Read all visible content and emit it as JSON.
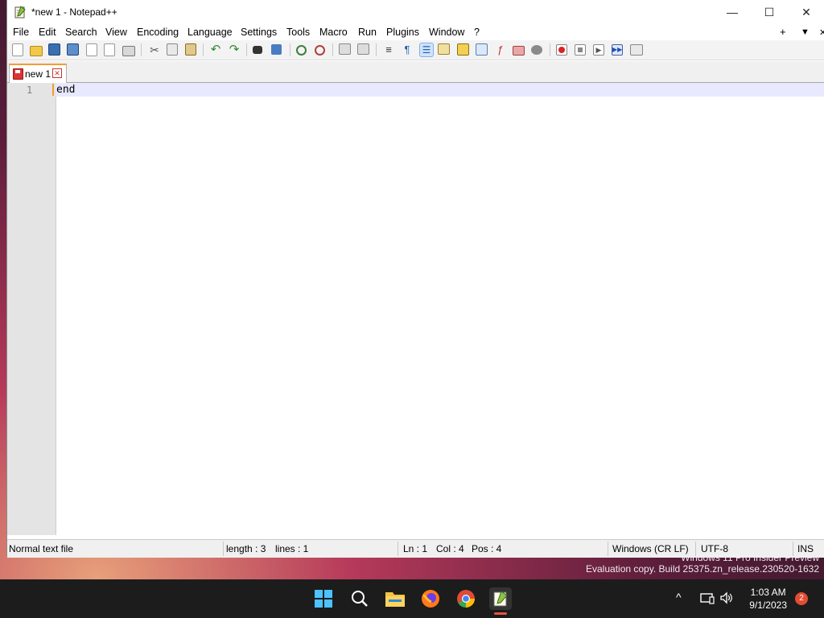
{
  "window": {
    "title": "*new 1 - Notepad++",
    "minimize_glyph": "—",
    "maximize_glyph": "☐",
    "close_glyph": "✕"
  },
  "menu": {
    "items": [
      "File",
      "Edit",
      "Search",
      "View",
      "Encoding",
      "Language",
      "Settings",
      "Tools",
      "Macro",
      "Run",
      "Plugins",
      "Window",
      "?"
    ],
    "add_glyph": "+",
    "dropdown_glyph": "▼",
    "close_glyph": "✕"
  },
  "toolbar": {
    "icons": [
      "new-file-icon",
      "open-file-icon",
      "save-icon",
      "save-all-icon",
      "close-icon",
      "close-all-icon",
      "print-icon",
      "cut-icon",
      "copy-icon",
      "paste-icon",
      "undo-icon",
      "redo-icon",
      "find-icon",
      "replace-icon",
      "zoom-in-icon",
      "zoom-out-icon",
      "sync-vertical-icon",
      "sync-horizontal-icon",
      "word-wrap-icon",
      "show-all-chars-icon",
      "indent-guide-icon",
      "user-lang-icon",
      "doc-map-icon",
      "doc-list-icon",
      "function-list-icon",
      "folder-workspace-icon",
      "monitoring-icon",
      "record-macro-icon",
      "stop-macro-icon",
      "play-macro-icon",
      "run-macro-multiple-icon",
      "save-macro-icon"
    ]
  },
  "tab": {
    "label": "new 1",
    "close_glyph": "✕"
  },
  "editor": {
    "line_number": "1",
    "content": "end"
  },
  "status": {
    "file_type": "Normal text file",
    "length": "length : 3",
    "lines": "lines : 1",
    "ln": "Ln : 1",
    "col": "Col : 4",
    "pos": "Pos : 4",
    "eol": "Windows (CR LF)",
    "encoding": "UTF-8",
    "mode": "INS"
  },
  "desktop": {
    "watermark_line1": "Windows 11 Pro Insider Preview",
    "watermark_line2": "Evaluation copy. Build 25375.zn_release.230520-1632"
  },
  "taskbar": {
    "time": "1:03 AM",
    "date": "9/1/2023",
    "notification_count": "2",
    "tray_chevron": "^"
  },
  "colors": {
    "accent_orange": "#f39c2f",
    "current_line": "#e8e8ff",
    "taskbar": "#1c1c1c"
  }
}
